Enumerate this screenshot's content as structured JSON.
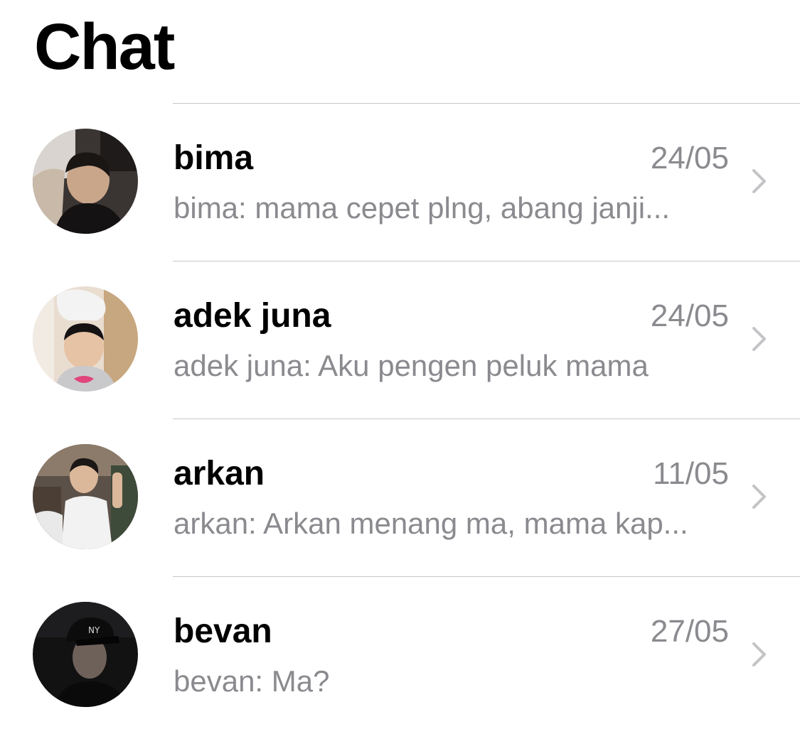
{
  "header": {
    "title": "Chat"
  },
  "chats": [
    {
      "name": "bima",
      "date": "24/05",
      "preview": "bima: mama cepet plng, abang janji...",
      "avatar_icon": "avatar-photo-bima"
    },
    {
      "name": "adek juna",
      "date": "24/05",
      "preview": "adek juna: Aku pengen peluk mama",
      "avatar_icon": "avatar-photo-adek-juna"
    },
    {
      "name": "arkan",
      "date": "11/05",
      "preview": "arkan: Arkan menang ma, mama kap...",
      "avatar_icon": "avatar-photo-arkan"
    },
    {
      "name": "bevan",
      "date": "27/05",
      "preview": "bevan: Ma?",
      "avatar_icon": "avatar-photo-bevan"
    }
  ],
  "colors": {
    "separator": "#c8c7cc",
    "secondary_text": "#8a8a8f",
    "chevron": "#c4c4c7"
  }
}
